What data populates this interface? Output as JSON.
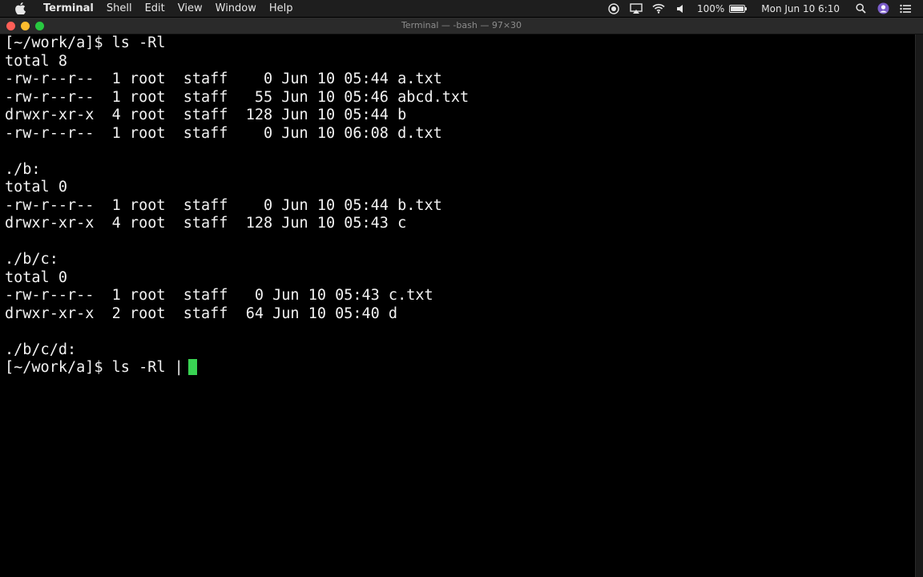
{
  "menubar": {
    "app_name": "Terminal",
    "items": [
      "Shell",
      "Edit",
      "View",
      "Window",
      "Help"
    ],
    "battery_percent": "100%",
    "battery_level": 1.0,
    "clock": "Mon Jun 10  6:10"
  },
  "window": {
    "title": "Terminal — -bash — 97×30",
    "traffic_colors": [
      "#ff5f57",
      "#febc2e",
      "#28c840"
    ]
  },
  "terminal": {
    "lines": [
      "[~/work/a]$ ls -Rl",
      "total 8",
      "-rw-r--r--  1 root  staff    0 Jun 10 05:44 a.txt",
      "-rw-r--r--  1 root  staff   55 Jun 10 05:46 abcd.txt",
      "drwxr-xr-x  4 root  staff  128 Jun 10 05:44 b",
      "-rw-r--r--  1 root  staff    0 Jun 10 06:08 d.txt",
      "",
      "./b:",
      "total 0",
      "-rw-r--r--  1 root  staff    0 Jun 10 05:44 b.txt",
      "drwxr-xr-x  4 root  staff  128 Jun 10 05:43 c",
      "",
      "./b/c:",
      "total 0",
      "-rw-r--r--  1 root  staff   0 Jun 10 05:43 c.txt",
      "drwxr-xr-x  2 root  staff  64 Jun 10 05:40 d",
      "",
      "./b/c/d:"
    ],
    "prompt_line": "[~/work/a]$ ls -Rl |",
    "cursor_color": "#39d353",
    "text_color": "#f2f2f2"
  }
}
